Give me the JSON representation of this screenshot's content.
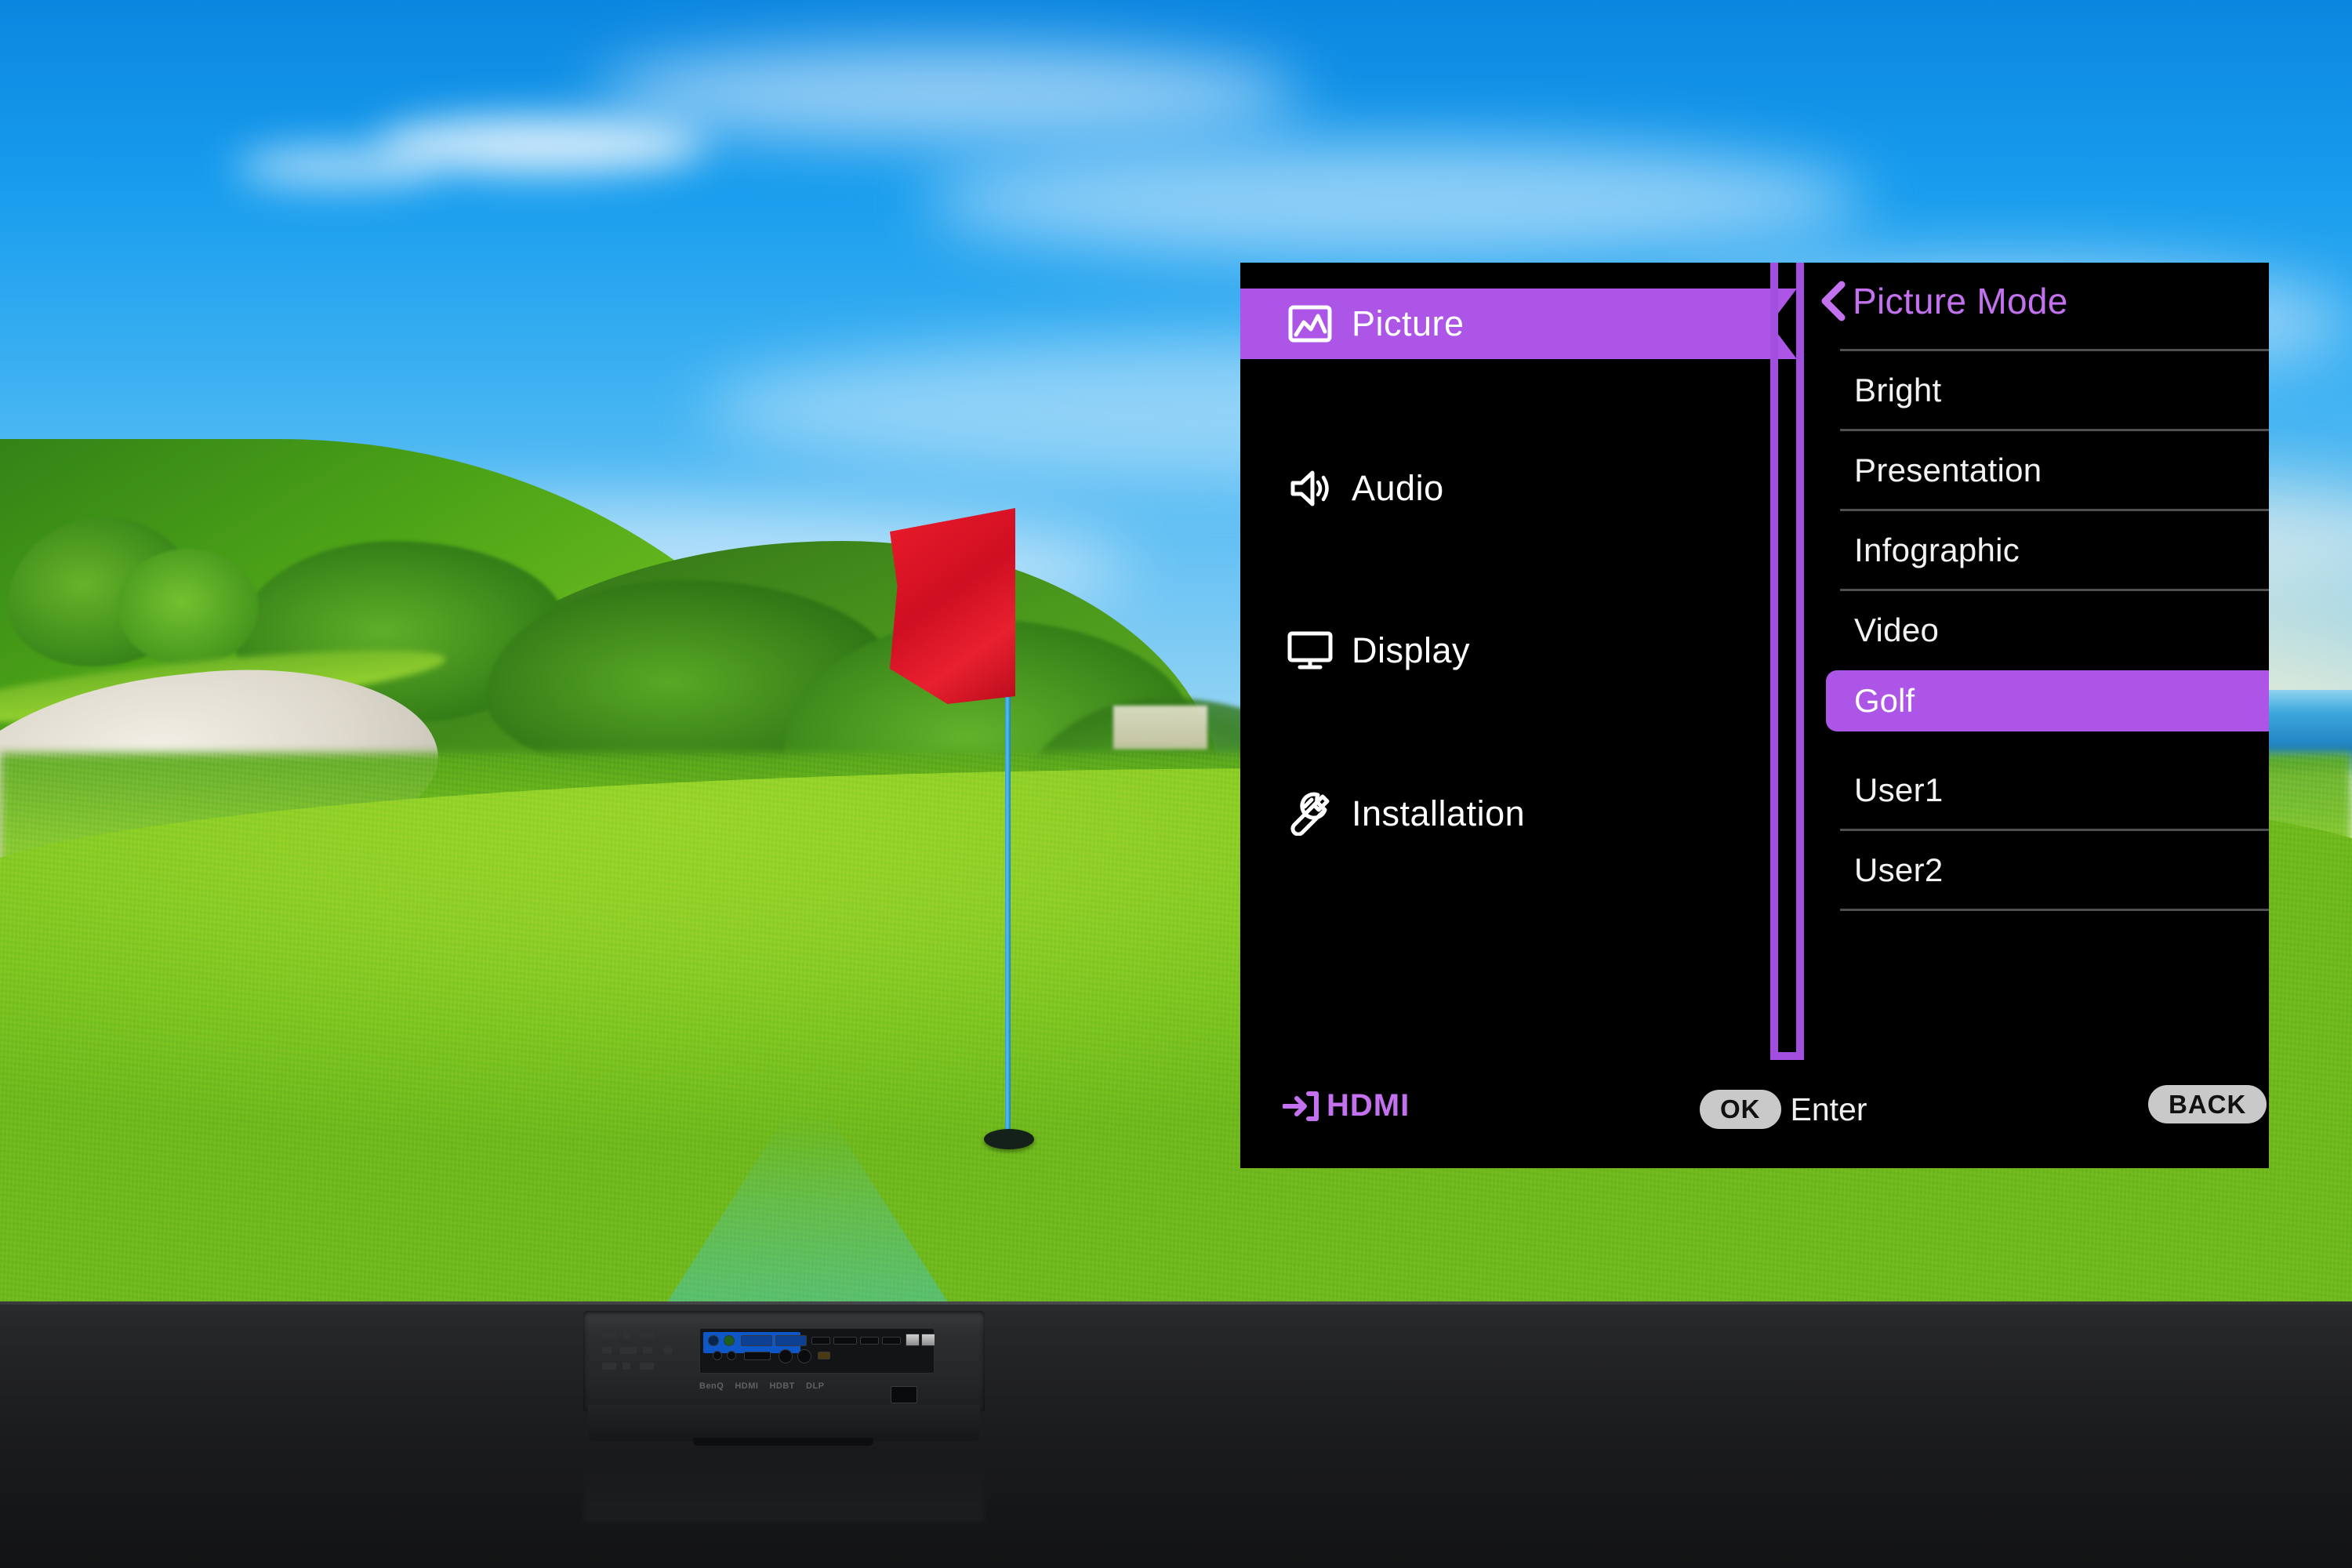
{
  "scene": {
    "description": "golf course putting green with red flag at sunset",
    "flag_color": "#e31b2a",
    "pole_color": "#3aa8e0",
    "green_color": "#8ece27",
    "sky_color": "#179ced",
    "beam_color": "#46cde6"
  },
  "projector": {
    "brand": "BenQ",
    "logos": [
      "BenQ",
      "HDMI",
      "HDBT",
      "DLP"
    ]
  },
  "osd": {
    "sidebar": {
      "items": [
        {
          "label": "Picture",
          "icon": "picture-icon",
          "selected": true
        },
        {
          "label": "Audio",
          "icon": "speaker-icon",
          "selected": false
        },
        {
          "label": "Display",
          "icon": "monitor-icon",
          "selected": false
        },
        {
          "label": "Installation",
          "icon": "wrench-icon",
          "selected": false
        }
      ]
    },
    "submenu": {
      "back_icon": "chevron-left-icon",
      "title": "Picture Mode",
      "options": [
        {
          "label": "Bright",
          "selected": false
        },
        {
          "label": "Presentation",
          "selected": false
        },
        {
          "label": "Infographic",
          "selected": false
        },
        {
          "label": "Video",
          "selected": false
        },
        {
          "label": "Golf",
          "selected": true
        },
        {
          "label": "User1",
          "selected": false
        },
        {
          "label": "User2",
          "selected": false
        }
      ]
    },
    "statusbar": {
      "source_icon": "input-source-icon",
      "source_label": "HDMI",
      "ok_label": "OK",
      "enter_label": "Enter",
      "back_label": "BACK"
    },
    "colors": {
      "highlight": "#ad55e6",
      "accent_text": "#c471f0",
      "panel_bg": "#000000",
      "divider": "#4e4f51",
      "border": "#a24fe0"
    }
  }
}
